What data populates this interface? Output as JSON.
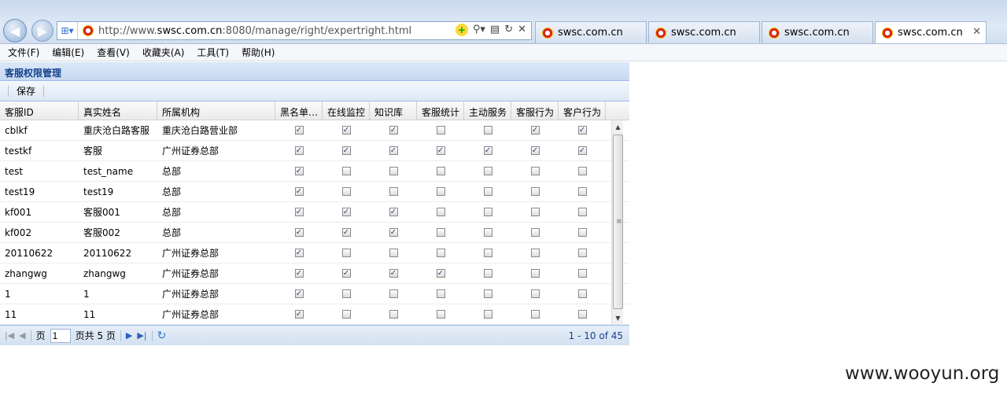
{
  "browser": {
    "address_url_prefix": "http://www.",
    "address_url_host": "swsc.com.cn",
    "address_url_rest": ":8080/manage/right/expertright.html",
    "tabs": [
      {
        "label": "swsc.com.cn",
        "active": false
      },
      {
        "label": "swsc.com.cn",
        "active": false
      },
      {
        "label": "swsc.com.cn",
        "active": false
      },
      {
        "label": "swsc.com.cn",
        "active": true
      }
    ]
  },
  "menu": [
    "文件(F)",
    "编辑(E)",
    "查看(V)",
    "收藏夹(A)",
    "工具(T)",
    "帮助(H)"
  ],
  "panel": {
    "title": "客服权限管理",
    "save_label": "保存"
  },
  "grid": {
    "columns": [
      "客服ID",
      "真实姓名",
      "所属机构",
      "黑名单…",
      "在线监控",
      "知识库",
      "客服统计",
      "主动服务",
      "客服行为",
      "客户行为"
    ],
    "rows": [
      {
        "id": "cblkf",
        "name": "重庆沧白路客服",
        "org": "重庆沧白路营业部",
        "perms": [
          true,
          true,
          true,
          false,
          false,
          true,
          true
        ]
      },
      {
        "id": "testkf",
        "name": "客服",
        "org": "广州证券总部",
        "perms": [
          true,
          true,
          true,
          true,
          true,
          true,
          true
        ]
      },
      {
        "id": "test",
        "name": "test_name",
        "org": "总部",
        "perms": [
          true,
          false,
          false,
          false,
          false,
          false,
          false
        ]
      },
      {
        "id": "test19",
        "name": "test19",
        "org": "总部",
        "perms": [
          true,
          false,
          false,
          false,
          false,
          false,
          false
        ]
      },
      {
        "id": "kf001",
        "name": "客服001",
        "org": "总部",
        "perms": [
          true,
          true,
          true,
          false,
          false,
          false,
          false
        ]
      },
      {
        "id": "kf002",
        "name": "客服002",
        "org": "总部",
        "perms": [
          true,
          true,
          true,
          false,
          false,
          false,
          false
        ]
      },
      {
        "id": "20110622",
        "name": "20110622",
        "org": "广州证券总部",
        "perms": [
          true,
          false,
          false,
          false,
          false,
          false,
          false
        ]
      },
      {
        "id": "zhangwg",
        "name": "zhangwg",
        "org": "广州证券总部",
        "perms": [
          true,
          true,
          true,
          true,
          false,
          false,
          false
        ]
      },
      {
        "id": "1",
        "name": "1",
        "org": "广州证券总部",
        "perms": [
          true,
          false,
          false,
          false,
          false,
          false,
          false
        ]
      },
      {
        "id": "11",
        "name": "11",
        "org": "广州证券总部",
        "perms": [
          true,
          false,
          false,
          false,
          false,
          false,
          false
        ]
      }
    ]
  },
  "pager": {
    "page_label": "页",
    "page_value": "1",
    "total_label": "页共 5 页",
    "count_text": "1 - 10 of 45"
  },
  "watermark": "www.wooyun.org",
  "icons": {
    "back": "back-arrow-icon",
    "forward": "forward-arrow-icon",
    "refresh": "refresh-icon",
    "close": "close-icon"
  }
}
